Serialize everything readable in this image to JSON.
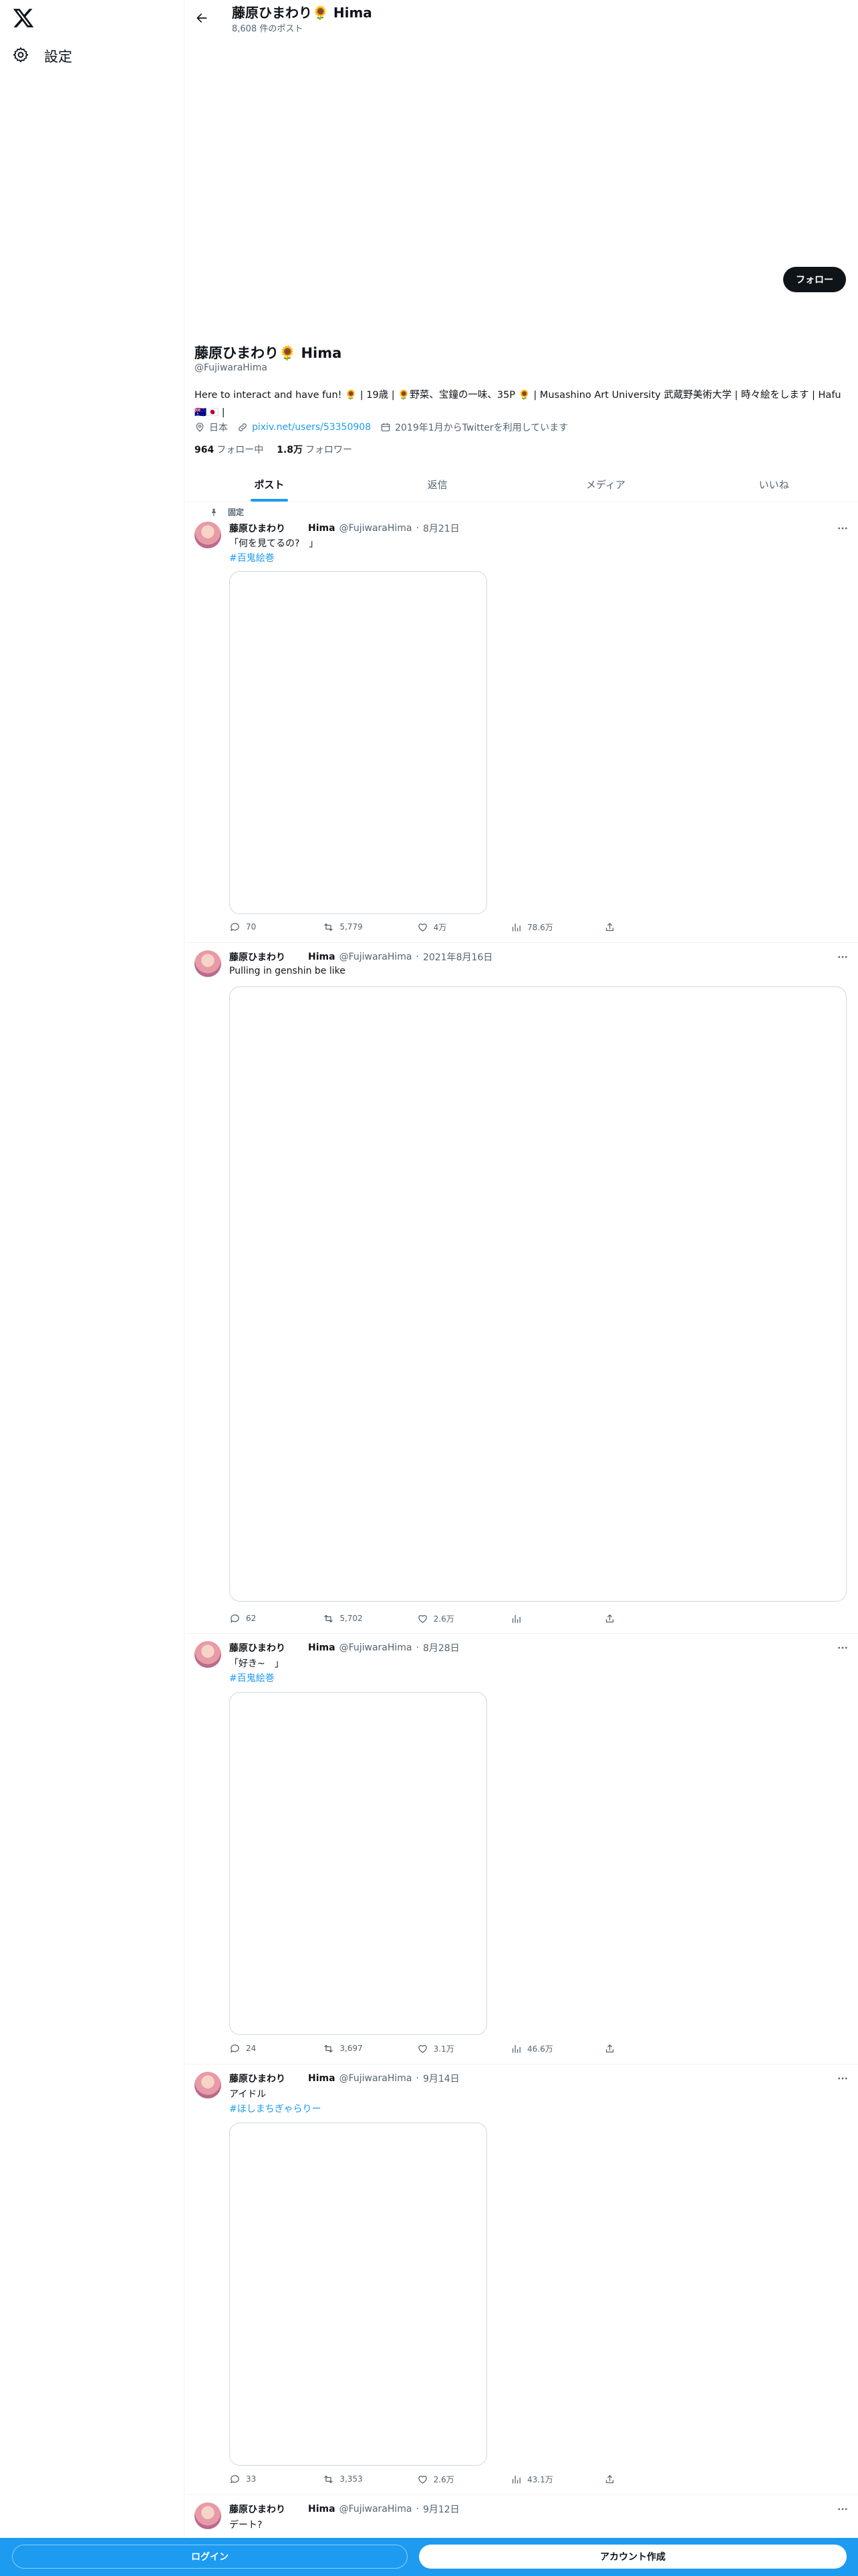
{
  "sidebar": {
    "logo_icon": "x-logo-icon",
    "settings_label": "設定",
    "settings_icon": "gear-icon"
  },
  "header": {
    "name": "藤原ひまわり🌻 Hima",
    "post_count": "8,608 件のポスト",
    "back_icon": "back-arrow-icon"
  },
  "profile": {
    "follow_label": "フォロー",
    "name": "藤原ひまわり🌻 Hima",
    "handle": "@FujiwaraHima",
    "bio": "Here to interact and have fun! 🌻 | 19歳 | 🌻野菜、宝鐘の一味、35P 🌻 | Musashino Art University 武蔵野美術大学 | 時々絵をします | Hafu 🇦🇺🇯🇵 |",
    "location": "日本",
    "link": "pixiv.net/users/53350908",
    "joined": "2019年1月からTwitterを利用しています",
    "following_count": "964",
    "following_label": "フォロー中",
    "followers_count": "1.8万",
    "followers_label": "フォロワー"
  },
  "tabs": [
    {
      "label": "ポスト",
      "active": true
    },
    {
      "label": "返信",
      "active": false
    },
    {
      "label": "メディア",
      "active": false
    },
    {
      "label": "いいね",
      "active": false
    }
  ],
  "posts": [
    {
      "pinned_label": "固定",
      "name": "藤原ひまわり",
      "name_suffix": "Hima",
      "handle": "@FujiwaraHima",
      "date": "8月21日",
      "text": "「何を見てるの?　」",
      "tag": "#百鬼絵巻",
      "replies": "70",
      "reposts": "5,779",
      "likes": "4万",
      "views": "78.6万"
    },
    {
      "name": "藤原ひまわり",
      "name_suffix": "Hima",
      "handle": "@FujiwaraHima",
      "date": "2021年8月16日",
      "text": "Pulling in genshin be like",
      "replies": "62",
      "reposts": "5,702",
      "likes": "2.6万",
      "views": ""
    },
    {
      "name": "藤原ひまわり",
      "name_suffix": "Hima",
      "handle": "@FujiwaraHima",
      "date": "8月28日",
      "text": "「好き~　」",
      "tag": "#百鬼絵巻",
      "replies": "24",
      "reposts": "3,697",
      "likes": "3.1万",
      "views": "46.6万"
    },
    {
      "name": "藤原ひまわり",
      "name_suffix": "Hima",
      "handle": "@FujiwaraHima",
      "date": "9月14日",
      "text": "アイドル",
      "tag": "#ほしまちぎゃらりー",
      "replies": "33",
      "reposts": "3,353",
      "likes": "2.6万",
      "views": "43.1万"
    },
    {
      "name": "藤原ひまわり",
      "name_suffix": "Hima",
      "handle": "@FujiwaraHima",
      "date": "9月12日",
      "text": "デート?"
    }
  ],
  "bottom_bar": {
    "login_label": "ログイン",
    "signup_label": "アカウント作成"
  },
  "colors": {
    "accent": "#1d9bf0",
    "text": "#0f1419",
    "muted": "#536471"
  }
}
